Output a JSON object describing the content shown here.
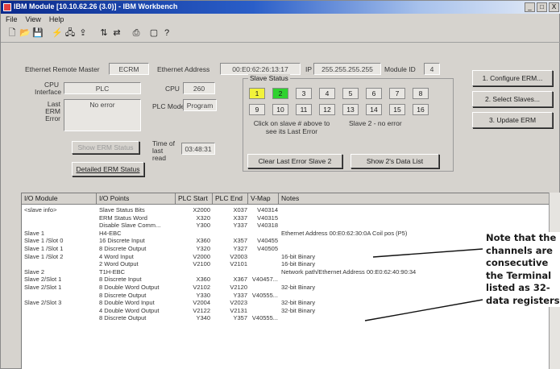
{
  "window": {
    "title": "IBM Module [10.10.62.26 (3.0)] - IBM Workbench",
    "buttons": [
      "_",
      "□",
      "X"
    ]
  },
  "menu": [
    "File",
    "View",
    "Help"
  ],
  "header": {
    "ethernet_module_label": "Ethernet Remote Master",
    "ethernet_module_value": "ECRM",
    "ethernet_address_label": "Ethernet Address",
    "ethernet_address_value": "00:E0:62:26:13:17",
    "ip_label": "IP",
    "ip_value": "255.255.255.255",
    "module_id_label": "Module ID",
    "module_id_value": "4"
  },
  "left": {
    "cpu_interface_label": "CPU Interface",
    "cpu_interface_value": "PLC",
    "cpu_label": "CPU",
    "cpu_value": "260",
    "last_error_label": "Last ERM Error",
    "last_error_value": "No error",
    "plc_mode_label": "PLC Mode",
    "plc_mode_value": "Program",
    "time_label": "Time of last read",
    "time_value": "03:48:31",
    "erm_status_button": "Show ERM Status",
    "detailed_status_button": "Detailed ERM Status"
  },
  "slave_status": {
    "title": "Slave Status",
    "slots": [
      "1",
      "2",
      "3",
      "4",
      "5",
      "6",
      "7",
      "8",
      "9",
      "10",
      "11",
      "12",
      "13",
      "14",
      "15",
      "16"
    ],
    "slot_colors": [
      "#f2f23a",
      "#2fd22f",
      "",
      "",
      "",
      "",
      "",
      "",
      "",
      "",
      "",
      "",
      "",
      "",
      "",
      ""
    ],
    "hint": "Click on slave # above to see its Last Error",
    "slave_message": "Slave 2 - no error",
    "clear_button": "Clear Last Error Slave 2",
    "show_data_button": "Show 2's Data List"
  },
  "right_buttons": [
    "1. Configure ERM...",
    "2. Select Slaves...",
    "3. Update ERM"
  ],
  "table": {
    "headers": [
      "I/O Module",
      "I/O Points",
      "PLC Start",
      "PLC End",
      "V-Map",
      "Notes"
    ],
    "rows": [
      [
        "<slave info>",
        "Slave Status Bits",
        "X2000",
        "X037",
        "V40314",
        ""
      ],
      [
        "",
        "ERM Status Word",
        "X320",
        "X337",
        "V40315",
        ""
      ],
      [
        "",
        "Disable Slave Comm...",
        "Y300",
        "Y337",
        "V40318",
        ""
      ],
      [
        "Slave 1",
        "H4-EBC",
        "",
        "",
        "",
        "Ethernet Address 00:E0:62:30:0A Coil pos (P5)"
      ],
      [
        "Slave 1 /Slot 0",
        "16 Discrete Input",
        "X360",
        "X357",
        "V40455",
        ""
      ],
      [
        "Slave 1 /Slot 1",
        "8 Discrete Output",
        "Y320",
        "Y327",
        "V40505",
        ""
      ],
      [
        "Slave 1 /Slot 2",
        "4 Word Input",
        "V2000",
        "V2003",
        "",
        "16-bit Binary"
      ],
      [
        "",
        "2 Word Output",
        "V2100",
        "V2101",
        "",
        "16-bit Binary"
      ],
      [
        "Slave 2",
        "T1H-EBC",
        "",
        "",
        "",
        "Network path/Ethernet Address 00:E0:62:40:90:34"
      ],
      [
        "Slave 2/Slot 1",
        "8 Discrete Input",
        "X360",
        "X367",
        "V40457...",
        ""
      ],
      [
        "Slave 2/Slot 1",
        "8 Double Word Output",
        "V2102",
        "V2120",
        "",
        "32-bit Binary"
      ],
      [
        "",
        "8 Discrete Output",
        "Y330",
        "Y337",
        "V40555...",
        ""
      ],
      [
        "Slave 2/Slot 3",
        "8 Double Word Input",
        "V2004",
        "V2023",
        "",
        "32-bit Binary"
      ],
      [
        "",
        "4 Double Word Output",
        "V2122",
        "V2131",
        "",
        "32-bit Binary"
      ],
      [
        "",
        "8 Discrete Output",
        "Y340",
        "Y357",
        "V40555...",
        ""
      ]
    ]
  },
  "callout": {
    "lines": [
      "Note that the",
      "channels are",
      "consecutive",
      "the Terminal",
      "listed as 32-",
      "data registers."
    ]
  }
}
